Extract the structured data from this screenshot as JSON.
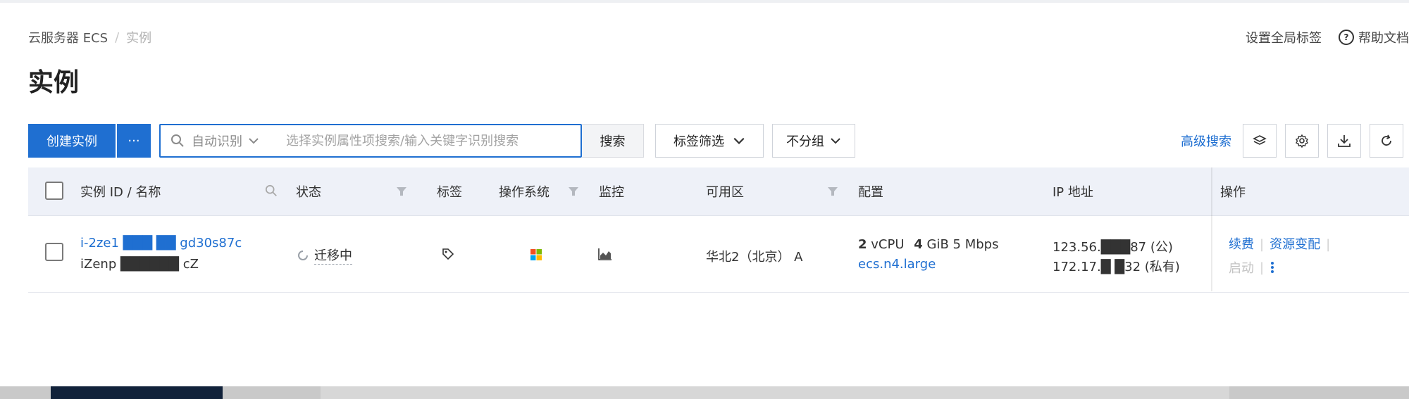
{
  "breadcrumb": {
    "root": "云服务器 ECS",
    "separator": "/",
    "current": "实例"
  },
  "page_title": "实例",
  "top_right": {
    "global_tags": "设置全局标签",
    "help_docs": "帮助文档"
  },
  "toolbar": {
    "create_instance": "创建实例",
    "more": "···",
    "auto_identify": "自动识别",
    "search_placeholder": "选择实例属性项搜索/输入关键字识别搜索",
    "search_button": "搜索",
    "tag_filter": "标签筛选",
    "group_none": "不分组",
    "advanced_search": "高级搜索"
  },
  "table": {
    "columns": [
      "实例 ID / 名称",
      "状态",
      "标签",
      "操作系统",
      "监控",
      "可用区",
      "配置",
      "IP 地址",
      "操作"
    ],
    "rows": [
      {
        "id": "i-2ze1  ███  ██  gd30s87c",
        "name": "iZenp  ██████  cZ",
        "status": "迁移中",
        "zone": "华北2（北京） A",
        "config_vcpu_num": "2",
        "config_vcpu_unit": "vCPU",
        "config_mem_num": "4",
        "config_mem_unit": "GiB 5 Mbps",
        "instance_type": "ecs.n4.large",
        "ip_public": "123.56.███87 (公)",
        "ip_private": "172.17.█ █32 (私有)",
        "op_renew": "续费",
        "op_change": "资源变配",
        "op_start": "启动"
      }
    ]
  },
  "colors": {
    "primary": "#1f6fd1",
    "header_bg": "#eef1f8"
  }
}
